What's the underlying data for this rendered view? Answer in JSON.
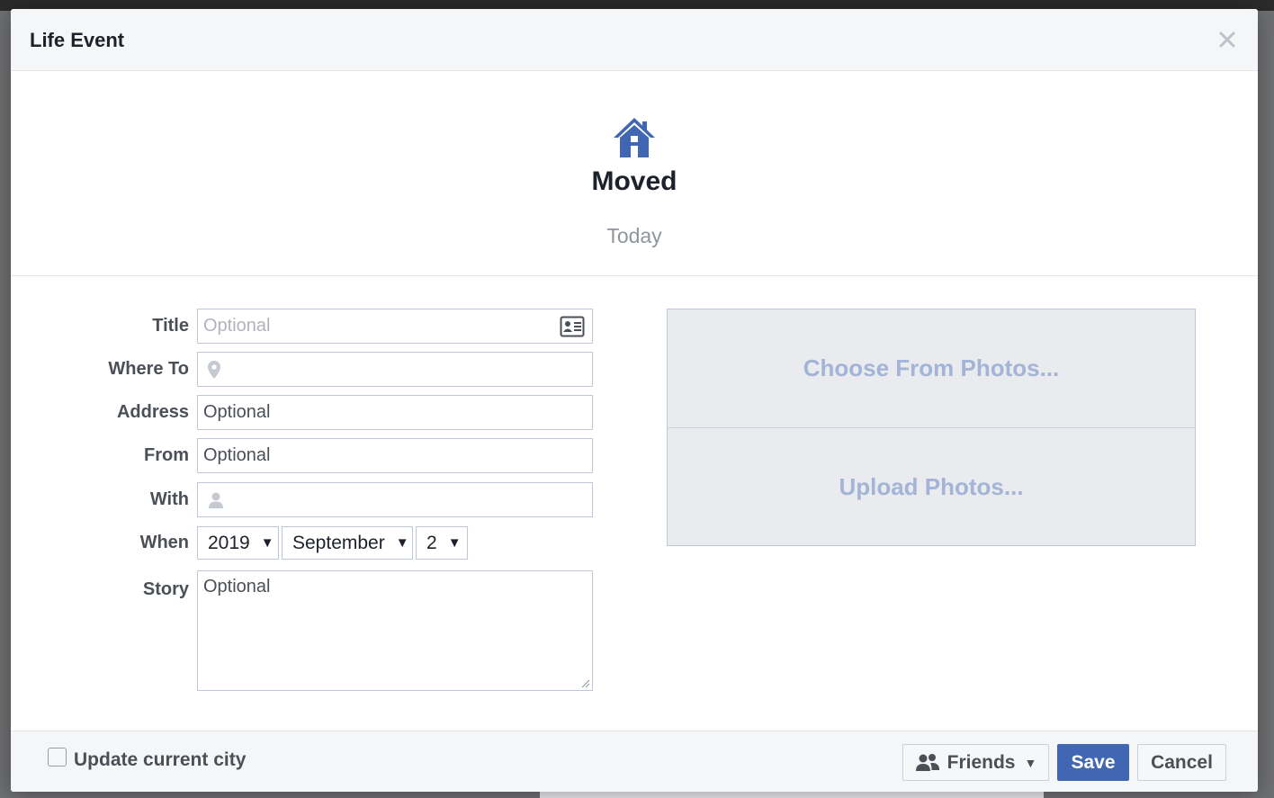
{
  "dialog": {
    "title": "Life Event",
    "close_icon": "close-icon"
  },
  "event": {
    "icon": "house-icon",
    "icon_color": "#4267b2",
    "name": "Moved",
    "date": "Today"
  },
  "form": {
    "title": {
      "label": "Title",
      "placeholder": "Optional",
      "icon": "contact-card-icon"
    },
    "where_to": {
      "label": "Where To",
      "icon": "location-pin-icon"
    },
    "address": {
      "label": "Address",
      "placeholder": "Optional"
    },
    "from": {
      "label": "From",
      "placeholder": "Optional"
    },
    "with": {
      "label": "With",
      "icon": "person-icon"
    },
    "when": {
      "label": "When",
      "year": "2019",
      "month": "September",
      "day": "2"
    },
    "story": {
      "label": "Story",
      "placeholder": "Optional"
    }
  },
  "photos": {
    "choose": "Choose From Photos...",
    "upload": "Upload Photos..."
  },
  "footer": {
    "update_city_label": "Update current city",
    "update_city_checked": false,
    "audience_label": "Friends",
    "audience_icon": "friends-icon",
    "save_label": "Save",
    "cancel_label": "Cancel"
  },
  "colors": {
    "primary": "#4267b2",
    "photo_text": "#a3b4d6"
  }
}
